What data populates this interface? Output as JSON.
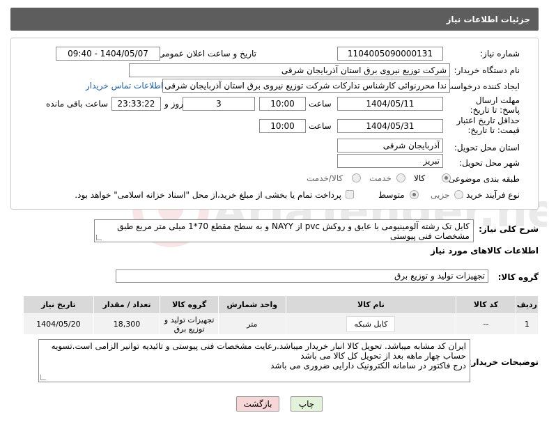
{
  "header": {
    "title": "جزئیات اطلاعات نیاز"
  },
  "fields": {
    "need_number_label": "شماره نیاز:",
    "need_number": "1104005090000131",
    "announce_label": "تاریخ و ساعت اعلان عمومی:",
    "announce_value": "1404/05/07 - 09:40",
    "buyer_org_label": "نام دستگاه خریدار:",
    "buyer_org": "شرکت توزیع نیروی برق استان آذربایجان شرقی",
    "creator_label": "ایجاد کننده درخواست:",
    "creator": "ندا محررنوائی کارشناس تدارکات شرکت توزیع نیروی برق استان آذربایجان شرقی",
    "buyer_contact_link": "اطلاعات تماس خریدار",
    "deadline_label": "مهلت ارسال پاسخ: تا تاریخ:",
    "deadline_date": "1404/05/11",
    "time_label": "ساعت",
    "deadline_time": "10:00",
    "days_count": "3",
    "days_label": "روز و",
    "remaining_time": "23:33:22",
    "remaining_label": "ساعت باقی مانده",
    "validity_label": "حداقل تاریخ اعتبار قیمت: تا تاریخ:",
    "validity_date": "1404/05/31",
    "validity_time": "10:00",
    "province_label": "استان محل تحویل:",
    "province": "آذربایجان شرقی",
    "city_label": "شهر محل تحویل:",
    "city": "تبریز",
    "category_label": "طبقه بندی موضوعی:",
    "category_options": [
      "کالا",
      "خدمت",
      "کالا/خدمت"
    ],
    "process_label": "نوع فرآیند خرید :",
    "process_options": [
      "جزیی",
      "متوسط"
    ],
    "payment_note": "پرداخت تمام یا بخشی از مبلغ خرید،از محل \"اسناد خزانه اسلامی\" خواهد بود."
  },
  "description": {
    "label": "شرح کلی نیاز:",
    "text": "کابل تک رشته آلومینیومی با عایق و روکش pvc از NAYY و به سطح مقطع 70*1 میلی متر مربع طبق مشخصات فنی پیوستی"
  },
  "goods": {
    "section_title": "اطلاعات کالاهای مورد نیاز",
    "group_label": "گروه کالا:",
    "group_value": "تجهیزات تولید و توزیع برق",
    "columns": [
      "ردیف",
      "کد کالا",
      "نام کالا",
      "واحد شمارش",
      "گروه کالا",
      "تعداد / مقدار",
      "تاریخ نیاز"
    ],
    "rows": [
      [
        "1",
        "--",
        "کابل شبکه",
        "متر",
        "تجهیزات تولید و توزیع برق",
        "18,300",
        "1404/05/20"
      ]
    ]
  },
  "buyer_notes": {
    "label": "توضیحات خریدار:",
    "lines": [
      "ایران کد مشابه میباشد. تحویل کالا انبار خریدار میباشد.رعایت مشخصات فنی پیوستی و تائیدیه توانیر الزامی است.تسویه حساب چهار ماهه بعد از تحویل کل کالا می باشد",
      "درج فاکتور در سامانه الکترونیک دارایی ضروری می باشد"
    ]
  },
  "buttons": {
    "print": "چاپ",
    "back": "بازگشت"
  },
  "watermark": {
    "text": "AriaTender.neT"
  },
  "colors": {
    "header_bg": "#5d5d5d",
    "link": "#1b5ea8",
    "back_bg": "#f6d6d6",
    "print_bg": "#e2f3d9"
  }
}
